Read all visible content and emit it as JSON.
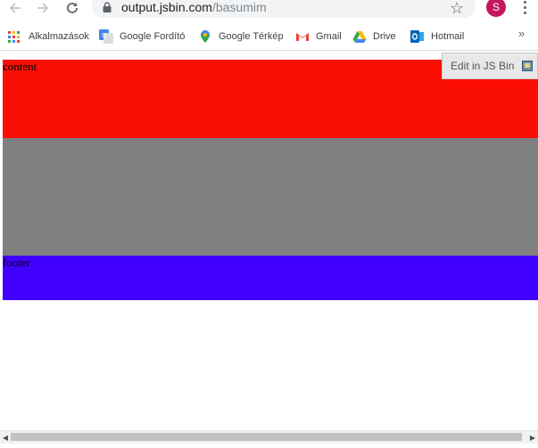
{
  "browser": {
    "url_host": "output.jsbin.com",
    "url_path": "/basumim",
    "profile_initial": "S",
    "icons": {
      "back": "back-arrow-icon",
      "forward": "forward-arrow-icon",
      "reload": "reload-icon",
      "lock": "lock-icon",
      "star": "star-icon",
      "menu": "menu-dots-icon"
    }
  },
  "bookmarks": {
    "items": [
      {
        "label": "Alkalmazások",
        "icon": "apps-grid-icon"
      },
      {
        "label": "Google Fordító",
        "icon": "google-translate-icon"
      },
      {
        "label": "Google Térkép",
        "icon": "google-maps-icon"
      },
      {
        "label": "Gmail",
        "icon": "gmail-icon"
      },
      {
        "label": "Drive",
        "icon": "google-drive-icon"
      },
      {
        "label": "Hotmail",
        "icon": "outlook-icon"
      }
    ],
    "overflow": "»"
  },
  "page": {
    "content_label": "content",
    "footer_label": "footer",
    "jsbin_button": "Edit in JS Bin",
    "colors": {
      "content": "#fb0f05",
      "middle": "#808080",
      "footer": "#4200ff"
    }
  }
}
